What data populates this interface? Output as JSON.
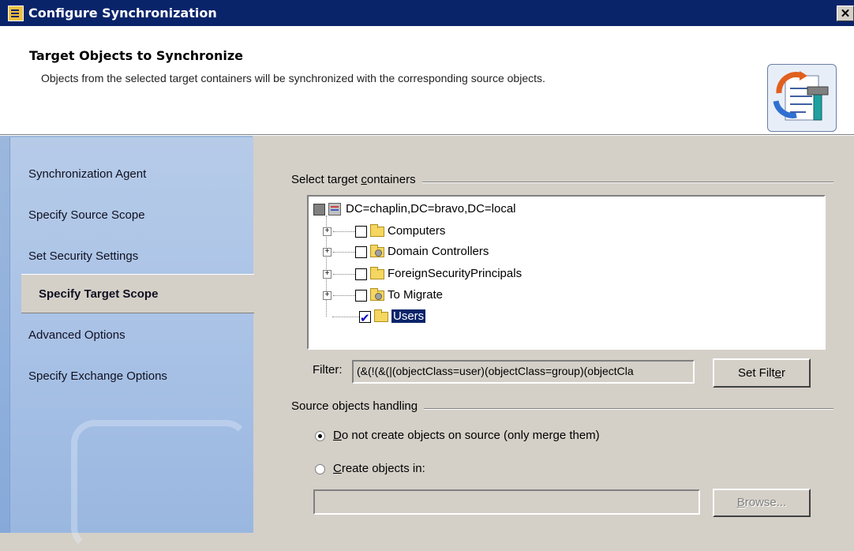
{
  "window": {
    "title": "Configure Synchronization",
    "close_label": "✕"
  },
  "header": {
    "title": "Target Objects to Synchronize",
    "description": "Objects from the selected target containers will be synchronized with the corresponding source objects."
  },
  "sidebar": {
    "items": [
      {
        "label": "Synchronization Agent"
      },
      {
        "label": "Specify Source Scope"
      },
      {
        "label": "Set Security Settings"
      },
      {
        "label": "Specify Target Scope",
        "active": true
      },
      {
        "label": "Advanced Options"
      },
      {
        "label": "Specify Exchange Options"
      }
    ]
  },
  "containers": {
    "title_prefix": "Select target ",
    "title_accel": "c",
    "title_suffix": "ontainers",
    "root": {
      "label": "DC=chaplin,DC=bravo,DC=local",
      "state": "mixed"
    },
    "children": [
      {
        "label": "Computers",
        "checked": false,
        "icon": "folder-icon",
        "expandable": true
      },
      {
        "label": "Domain Controllers",
        "checked": false,
        "icon": "ou-folder-icon",
        "expandable": true
      },
      {
        "label": "ForeignSecurityPrincipals",
        "checked": false,
        "icon": "folder-icon",
        "expandable": true
      },
      {
        "label": "To Migrate",
        "checked": false,
        "icon": "ou-folder-icon",
        "expandable": true
      },
      {
        "label": "Users",
        "checked": true,
        "icon": "folder-icon",
        "expandable": false,
        "selected": true
      }
    ]
  },
  "filter": {
    "label": "Filter:",
    "value": "(&(!(&(|(objectClass=user)(objectClass=group)(objectCla",
    "button_prefix": "Set Filt",
    "button_accel": "e",
    "button_suffix": "r"
  },
  "source_handling": {
    "title": "Source objects handling",
    "options": [
      {
        "accel": "D",
        "rest": "o not create objects on source (only merge them)",
        "selected": true
      },
      {
        "accel": "C",
        "rest": "reate objects in:",
        "selected": false
      }
    ],
    "path_value": "",
    "browse_accel": "B",
    "browse_rest": "rowse..."
  },
  "colors": {
    "titlebar": "#0a246a",
    "sidebar": "#9cb7dc",
    "dialog": "#d4d0c8"
  }
}
